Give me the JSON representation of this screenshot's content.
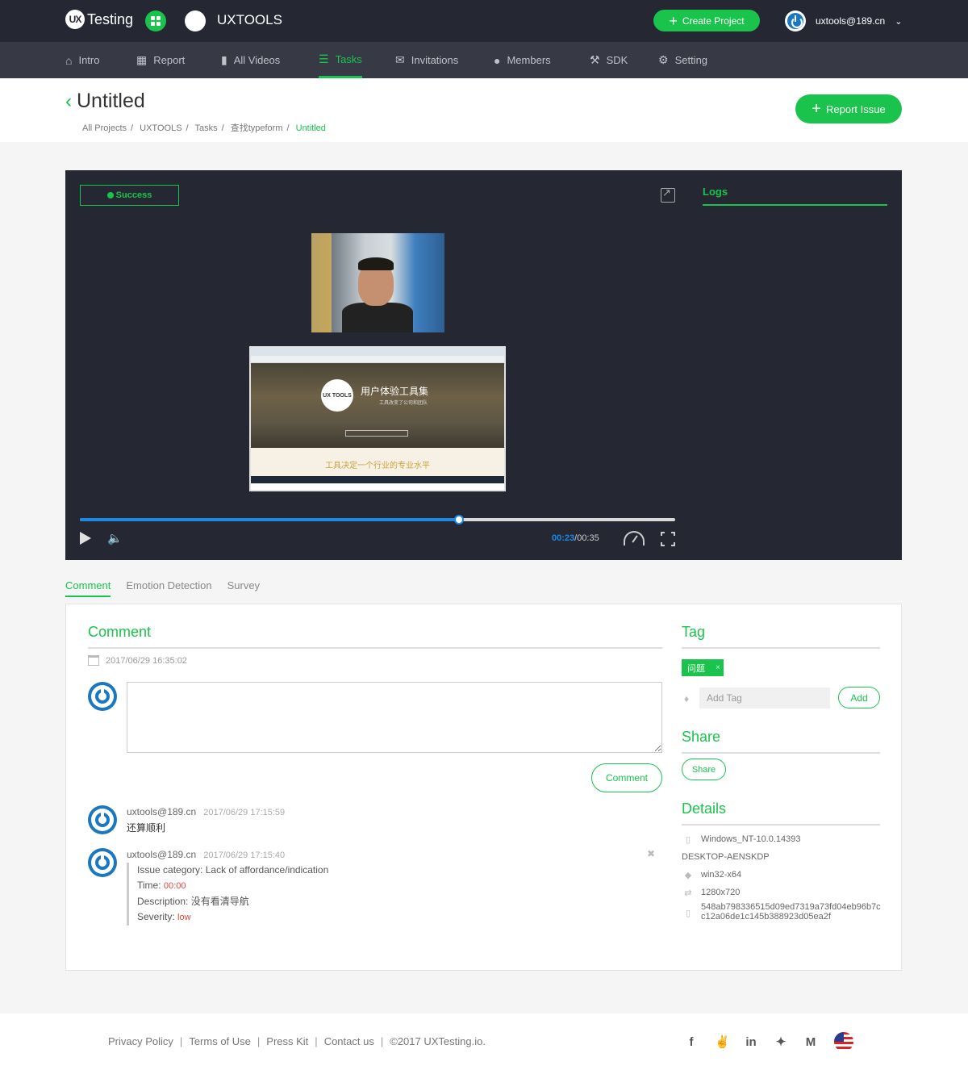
{
  "topbar": {
    "logo_badge": "UX",
    "logo_text": "Testing",
    "project_name": "UXTOOLS",
    "create_project": "Create Project",
    "user_email": "uxtools@189.cn"
  },
  "nav": [
    {
      "label": "Intro",
      "icon": "home-icon"
    },
    {
      "label": "Report",
      "icon": "bar-chart-icon"
    },
    {
      "label": "All Videos",
      "icon": "video-camera-icon"
    },
    {
      "label": "Tasks",
      "icon": "list-icon",
      "active": true
    },
    {
      "label": "Invitations",
      "icon": "envelope-icon"
    },
    {
      "label": "Members",
      "icon": "users-icon"
    },
    {
      "label": "SDK",
      "icon": "wrench-icon"
    },
    {
      "label": "Setting",
      "icon": "gear-icon"
    }
  ],
  "page": {
    "title": "Untitled",
    "breadcrumb": [
      "All Projects",
      "UXTOOLS",
      "Tasks",
      "查找typeform",
      "Untitled"
    ],
    "report_issue": "Report Issue"
  },
  "player": {
    "status": "Success",
    "logs_tab": "Logs",
    "current_time": "00:23",
    "duration": "/00:35",
    "progress": 0.637,
    "screen_title": "用户体验工具集",
    "screen_subtitle": "工具改变了公司和团队",
    "screen_logo": "UX TOOLS",
    "screen_slogan": "工具决定一个行业的专业水平"
  },
  "tabs": [
    "Comment",
    "Emotion Detection",
    "Survey"
  ],
  "comment": {
    "heading": "Comment",
    "date": "2017/06/29 16:35:02",
    "textarea_value": "",
    "submit": "Comment",
    "items": [
      {
        "user": "uxtools@189.cn",
        "time": "2017/06/29 17:15:59",
        "text": "还算顺利"
      },
      {
        "user": "uxtools@189.cn",
        "time": "2017/06/29 17:15:40",
        "issue_category_label": "Issue category:",
        "issue_category": "Lack of affordance/indication",
        "time_label": "Time:",
        "time_value": "00:00",
        "description_label": "Description:",
        "description": "没有看清导航",
        "severity_label": "Severity:",
        "severity": "low"
      }
    ]
  },
  "tag": {
    "heading": "Tag",
    "chip": "问题",
    "chip_close": "×",
    "input_placeholder": "Add Tag",
    "add": "Add"
  },
  "share": {
    "heading": "Share",
    "button": "Share"
  },
  "details": {
    "heading": "Details",
    "os": "Windows_NT-10.0.14393",
    "host": "DESKTOP-AENSKDP",
    "arch": "win32-x64",
    "resolution": "1280x720",
    "id_line1": "548ab798336515d09ed7319a73fd04eb96b7c",
    "id_line2": "c12a06de1c145b388923d05ea2f"
  },
  "footer": {
    "links": [
      "Privacy Policy",
      "Terms of Use",
      "Press Kit",
      "Contact us",
      "©2017 UXTesting.io."
    ]
  },
  "colors": {
    "accent": "#19c34c",
    "dark": "#252833",
    "nav": "#373a45",
    "progress": "#1e88e5"
  }
}
